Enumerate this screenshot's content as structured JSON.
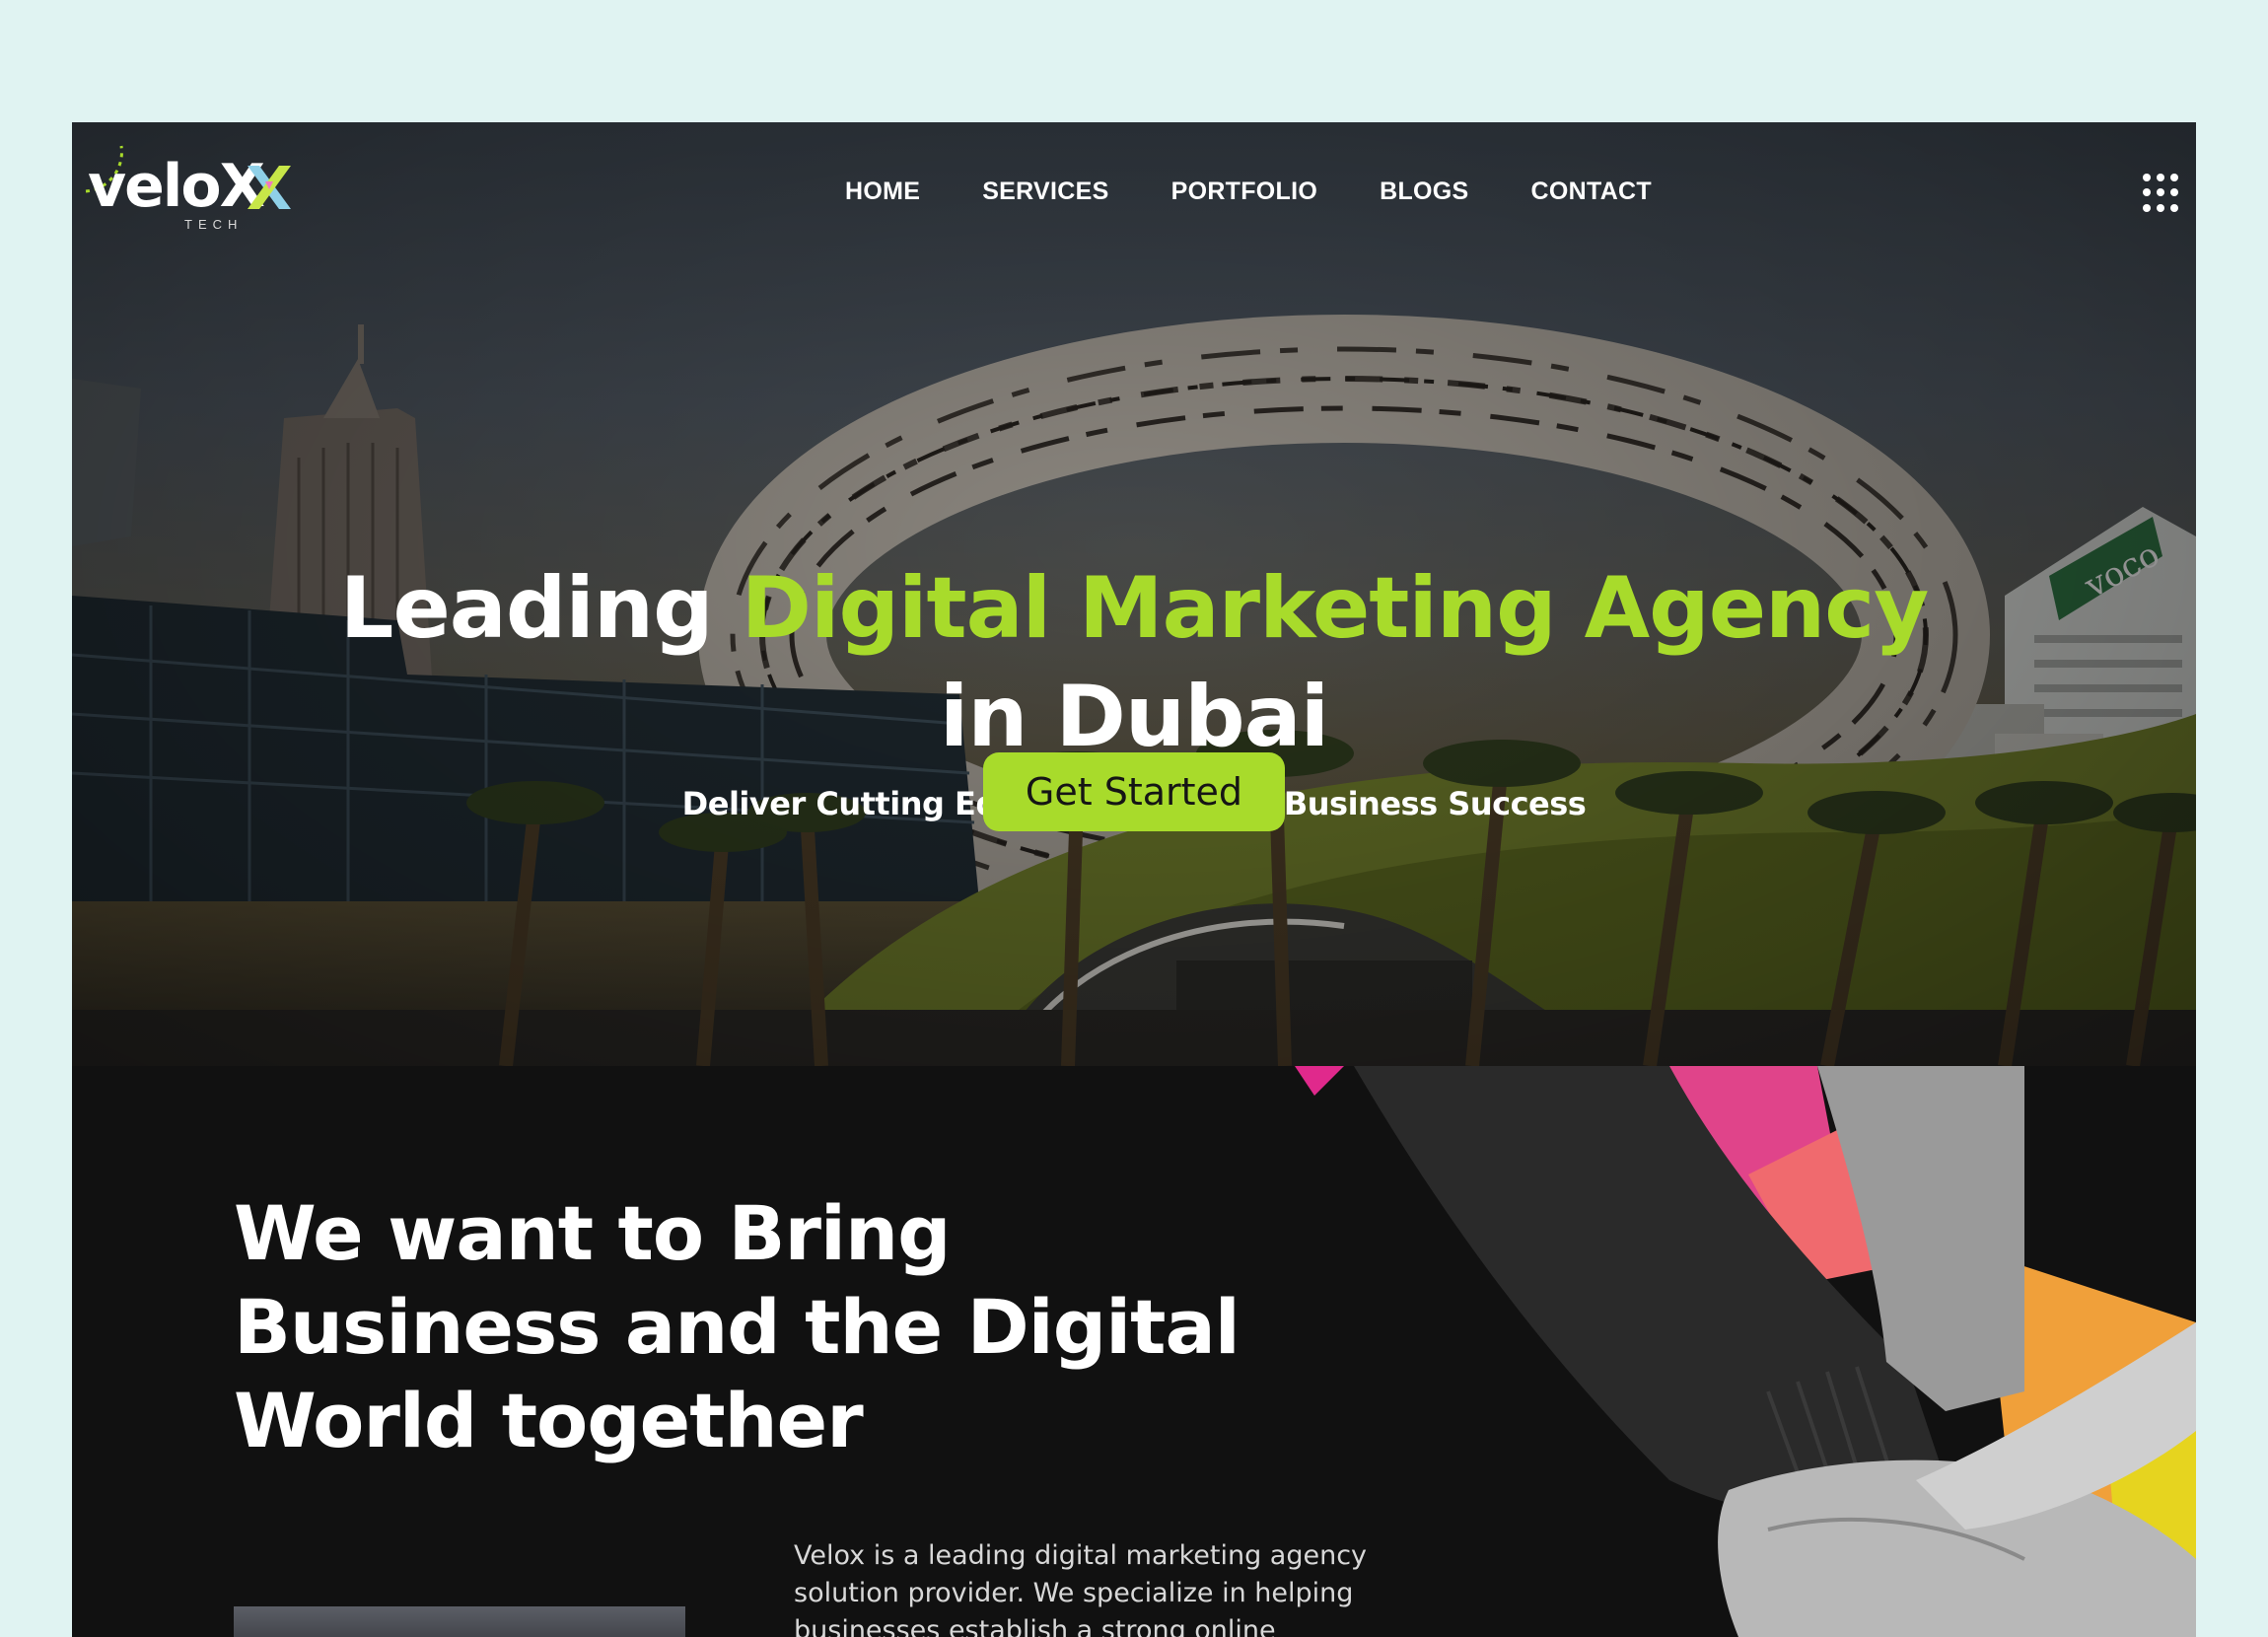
{
  "header": {
    "logo_word": "veloX",
    "logo_sub": "TECH",
    "nav": [
      "HOME",
      "SERVICES",
      "PORTFOLIO",
      "BLOGS",
      "CONTACT"
    ],
    "menu_icon": "grid-dots-icon"
  },
  "hero": {
    "title_lead": "Leading",
    "title_accent": "Digital Marketing Agency",
    "title_tail": "in Dubai",
    "subtitle": "Deliver Cutting Edge Solutions for Business Success",
    "cta_label": "Get Started",
    "sign_text": "voco"
  },
  "about": {
    "title_line1": "We want to Bring",
    "title_line2": "Business and the Digital",
    "title_line3": "World together",
    "text": "Velox is a leading digital marketing agency solution provider. We specialize in helping businesses establish a strong online"
  },
  "colors": {
    "accent": "#a8db2b",
    "page_bg": "#e0f3f2",
    "dark_bg": "#111111"
  }
}
